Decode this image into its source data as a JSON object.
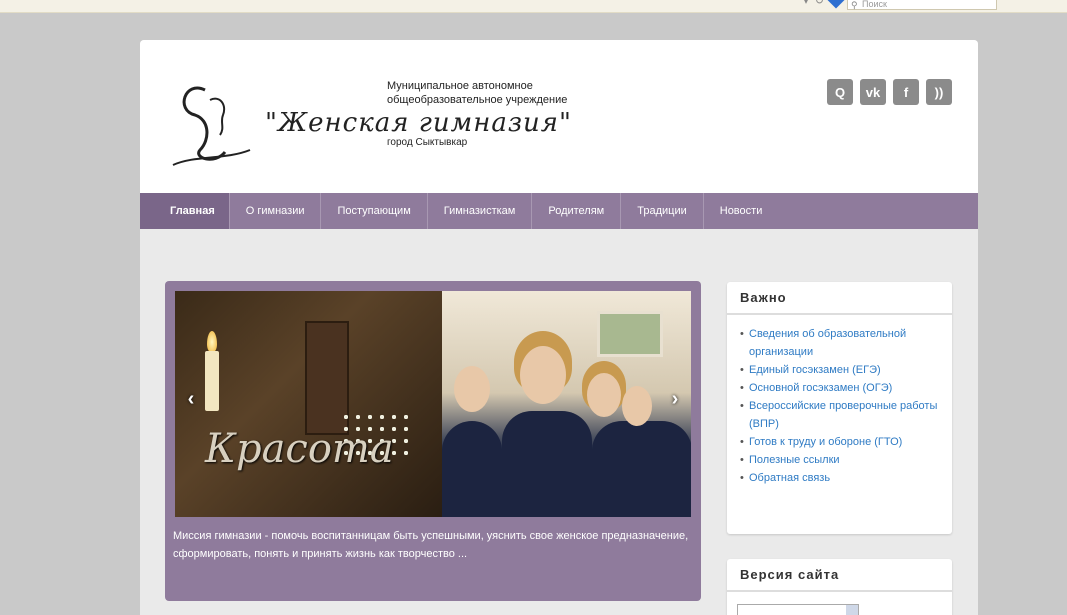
{
  "browser": {
    "search_placeholder": "Поиск"
  },
  "header": {
    "org_line1": "Муниципальное автономное",
    "org_line2": "общеобразовательное учреждение",
    "title": "\"Женская гимназия\"",
    "city": "город Сыктывкар"
  },
  "social": [
    {
      "icon": "search-icon",
      "label": "Q"
    },
    {
      "icon": "vk-icon",
      "label": "vk"
    },
    {
      "icon": "facebook-icon",
      "label": "f"
    },
    {
      "icon": "rss-icon",
      "label": "))"
    }
  ],
  "nav": [
    "Главная",
    "О гимназии",
    "Поступающим",
    "Гимназисткам",
    "Родителям",
    "Традиции",
    "Новости"
  ],
  "slider": {
    "caption": "Красота",
    "text": "Миссия гимназии - помочь воспитанницам быть успешными, уяснить свое женское предназначение, сформировать, понять и принять жизнь как творчество ..."
  },
  "important": {
    "title": "Важно",
    "links": [
      "Сведения об образовательной организации",
      "Единый госэкзамен (ЕГЭ)",
      "Основной госэкзамен (ОГЭ)",
      "Всероссийские проверочные работы (ВПР)",
      "Готов к труду и обороне (ГТО)",
      "Полезные ссылки",
      "Обратная связь"
    ]
  },
  "version": {
    "title": "Версия сайта"
  }
}
